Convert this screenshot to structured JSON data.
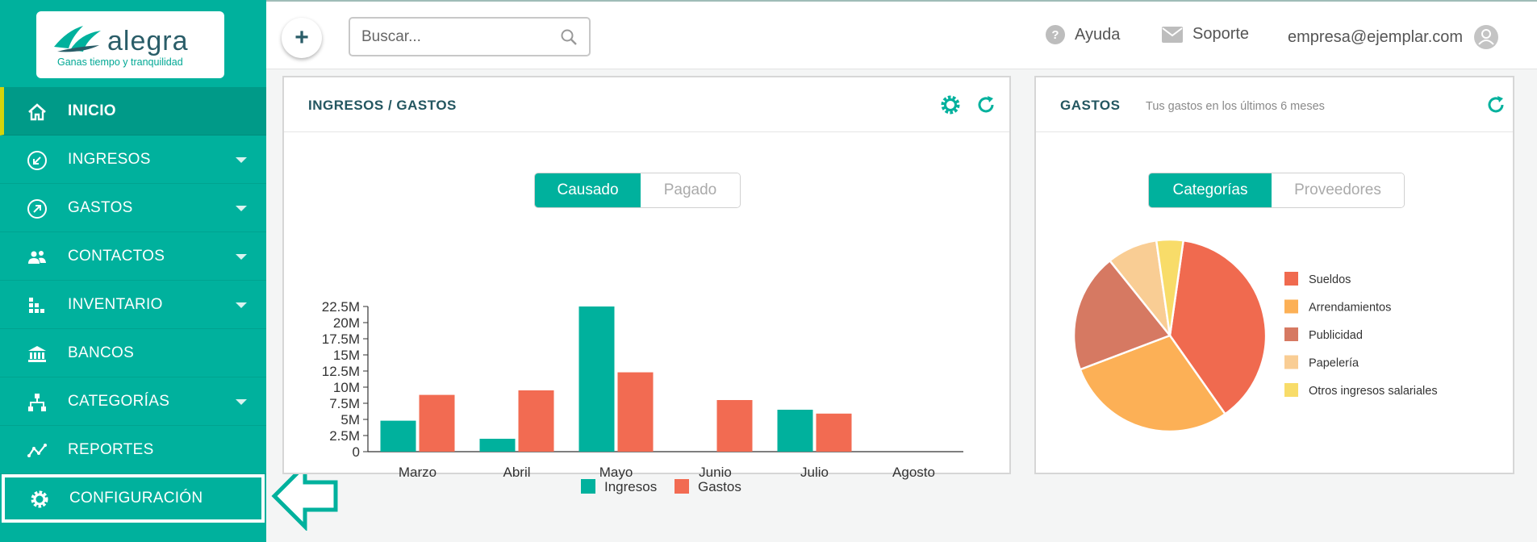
{
  "brand": {
    "name": "alegra",
    "tagline": "Ganas tiempo y tranquilidad"
  },
  "sidebar": {
    "items": [
      {
        "label": "INICIO",
        "icon": "home-icon",
        "active": true,
        "caret": false
      },
      {
        "label": "INGRESOS",
        "icon": "income-icon",
        "active": false,
        "caret": true
      },
      {
        "label": "GASTOS",
        "icon": "expense-icon",
        "active": false,
        "caret": true
      },
      {
        "label": "CONTACTOS",
        "icon": "contacts-icon",
        "active": false,
        "caret": true
      },
      {
        "label": "INVENTARIO",
        "icon": "inventory-icon",
        "active": false,
        "caret": true
      },
      {
        "label": "BANCOS",
        "icon": "bank-icon",
        "active": false,
        "caret": false
      },
      {
        "label": "CATEGORÍAS",
        "icon": "categories-icon",
        "active": false,
        "caret": true
      },
      {
        "label": "REPORTES",
        "icon": "reports-icon",
        "active": false,
        "caret": false
      },
      {
        "label": "CONFIGURACIÓN",
        "icon": "gear-icon",
        "active": false,
        "caret": false,
        "highlighted": true
      }
    ]
  },
  "topbar": {
    "add_label": "+",
    "search_placeholder": "Buscar...",
    "help_label": "Ayuda",
    "support_label": "Soporte",
    "user_email": "empresa@ejemplar.com"
  },
  "income_card": {
    "title": "INGRESOS / GASTOS",
    "toggle": [
      "Causado",
      "Pagado"
    ],
    "toggle_selected": "Causado"
  },
  "expense_card": {
    "title": "GASTOS",
    "subtitle": "Tus gastos en los últimos 6 meses",
    "toggle": [
      "Categorías",
      "Proveedores"
    ],
    "toggle_selected": "Categorías"
  },
  "colors": {
    "brand": "#00b19d",
    "ingresos": "#00b19d",
    "gastos": "#f26b52",
    "highlight": "#d4d40c"
  },
  "chart_data": [
    {
      "type": "bar",
      "categories": [
        "Marzo",
        "Abril",
        "Mayo",
        "Junio",
        "Julio",
        "Agosto"
      ],
      "series": [
        {
          "name": "Ingresos",
          "color": "#00b19d",
          "values": [
            4.8,
            2.0,
            22.5,
            0,
            6.5,
            0
          ]
        },
        {
          "name": "Gastos",
          "color": "#f26b52",
          "values": [
            8.8,
            9.5,
            12.3,
            8.0,
            5.9,
            0
          ]
        }
      ],
      "yticks": [
        "0",
        "2.5M",
        "5M",
        "7.5M",
        "10M",
        "12.5M",
        "15M",
        "17.5M",
        "20M",
        "22.5M"
      ],
      "ylim": [
        0,
        22.5
      ],
      "legend": "bottom"
    },
    {
      "type": "pie",
      "slices": [
        {
          "label": "Sueldos",
          "value": 38,
          "color": "#f06a4f"
        },
        {
          "label": "Arrendamientos",
          "value": 29,
          "color": "#fcb056"
        },
        {
          "label": "Publicidad",
          "value": 20,
          "color": "#d67962"
        },
        {
          "label": "Papelería",
          "value": 8.5,
          "color": "#f9cd94"
        },
        {
          "label": "Otros ingresos salariales",
          "value": 4.5,
          "color": "#f8dc69"
        }
      ],
      "legend": "right"
    }
  ]
}
